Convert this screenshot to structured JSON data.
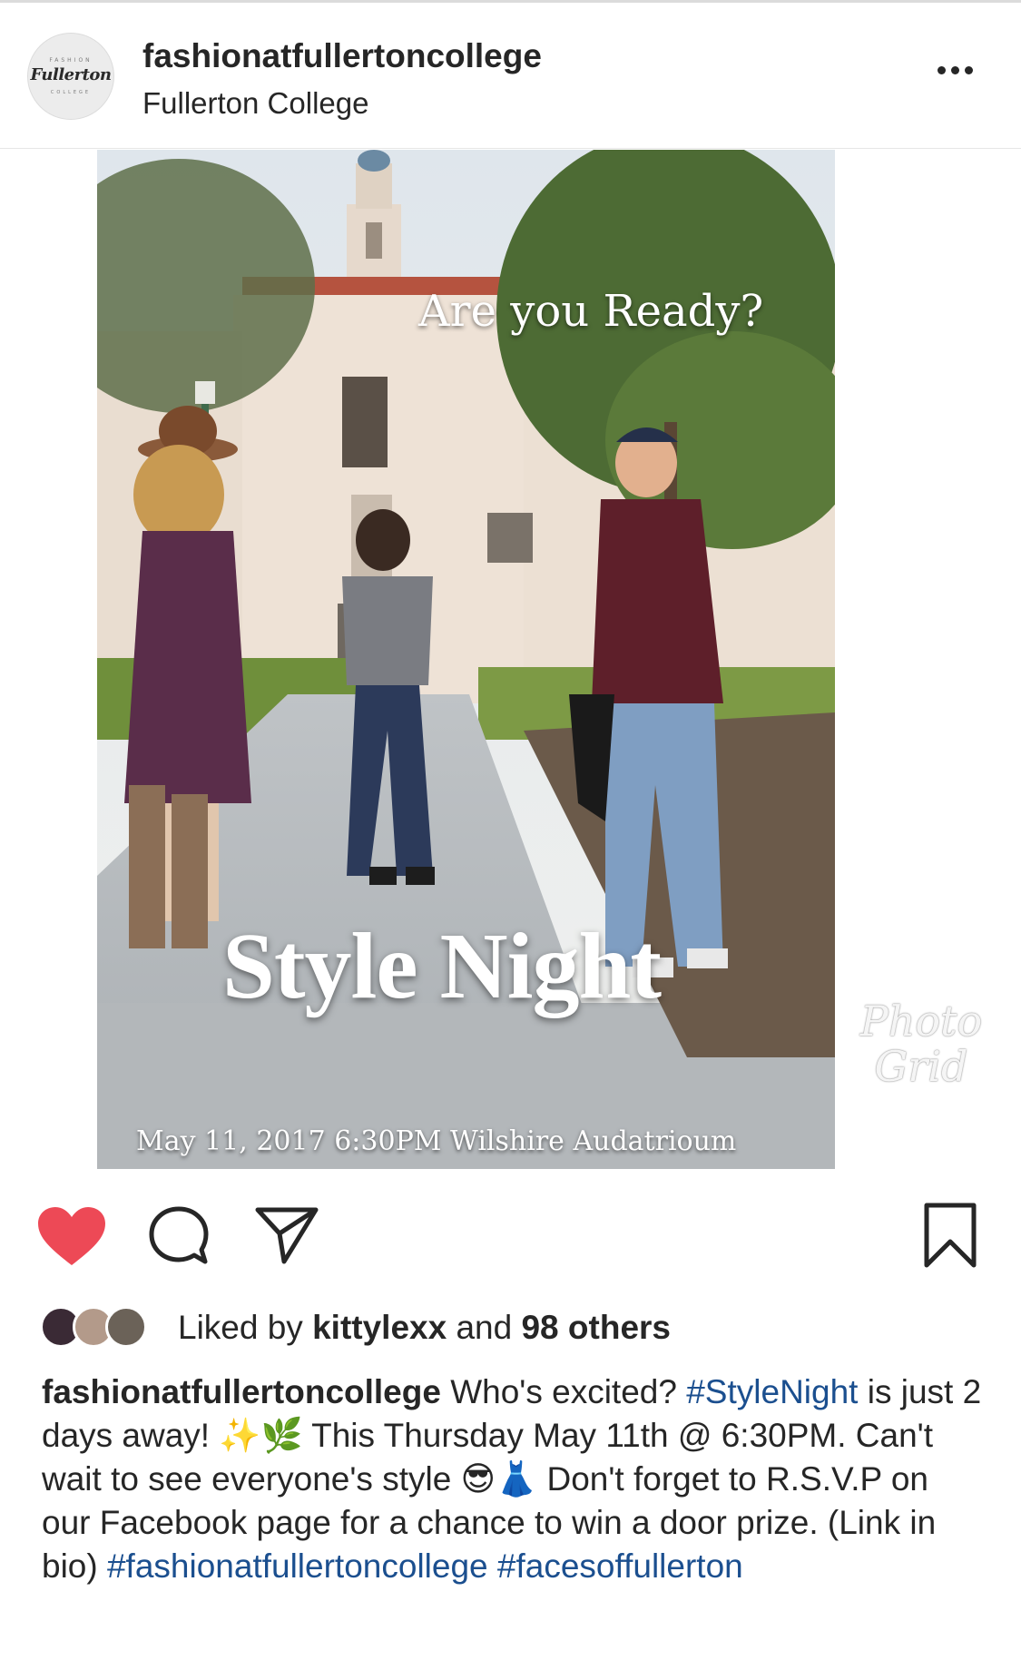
{
  "header": {
    "avatar_top": "FASHION",
    "avatar_script": "Fullerton",
    "avatar_bottom": "COLLEGE",
    "username": "fashionatfullertoncollege",
    "location": "Fullerton College"
  },
  "post_image": {
    "headline": "Are you Ready?",
    "event_title": "Style Night",
    "event_details": "May 11, 2017 6:30PM Wilshire Audatrioum",
    "watermark_line1": "Photo",
    "watermark_line2": "Grid"
  },
  "actions": {
    "like_icon": "heart-filled-icon",
    "comment_icon": "comment-bubble-icon",
    "share_icon": "paper-plane-icon",
    "save_icon": "bookmark-icon",
    "liked": true,
    "like_color": "#ed4956"
  },
  "likes": {
    "prefix": "Liked by ",
    "first_liker": "kittylexx",
    "middle": " and ",
    "others": "98 others"
  },
  "caption": {
    "username": "fashionatfullertoncollege",
    "text_1": " Who's excited?",
    "hashtag_1": "#StyleNight",
    "text_2": " is just 2 days away! ✨🌿 This Thursday May 11th @ 6:30PM. Can't wait to see everyone's style 😎👗 Don't forget to R.S.V.P on our Facebook page for a chance to win a door prize. (Link in bio)",
    "hashtag_2": "#fashionatfullertoncollege",
    "hashtag_3": "#facesoffullerton"
  }
}
